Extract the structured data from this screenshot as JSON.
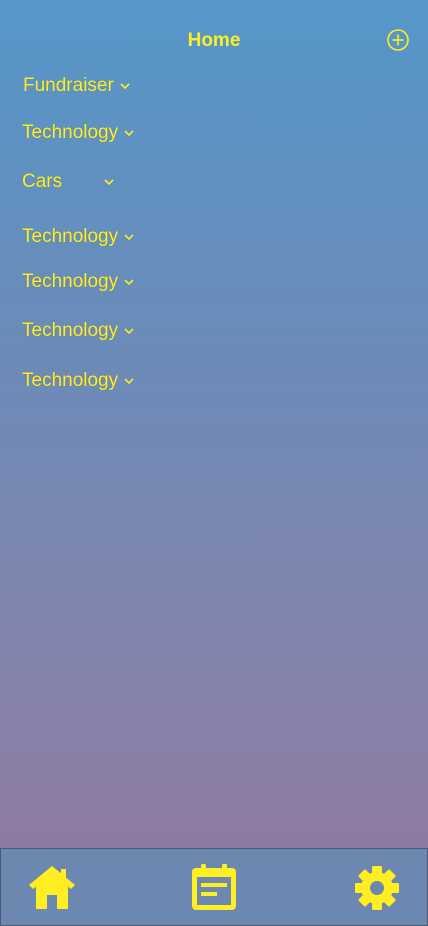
{
  "header": {
    "title": "Home",
    "add_icon": "plus-circle-icon"
  },
  "categories": [
    {
      "label": "Fundraiser"
    },
    {
      "label": "Technology"
    },
    {
      "label": "Cars"
    },
    {
      "label": "Technology"
    },
    {
      "label": "Technology"
    },
    {
      "label": "Technology"
    },
    {
      "label": "Technology"
    }
  ],
  "tabbar": {
    "items": [
      {
        "icon": "home-icon"
      },
      {
        "icon": "notes-icon"
      },
      {
        "icon": "gear-icon"
      }
    ]
  },
  "colors": {
    "accent": "#ffee22",
    "gradient_top": "#5597c9",
    "gradient_bottom": "#93759c",
    "tabbar_bg": "#6c87b0"
  }
}
